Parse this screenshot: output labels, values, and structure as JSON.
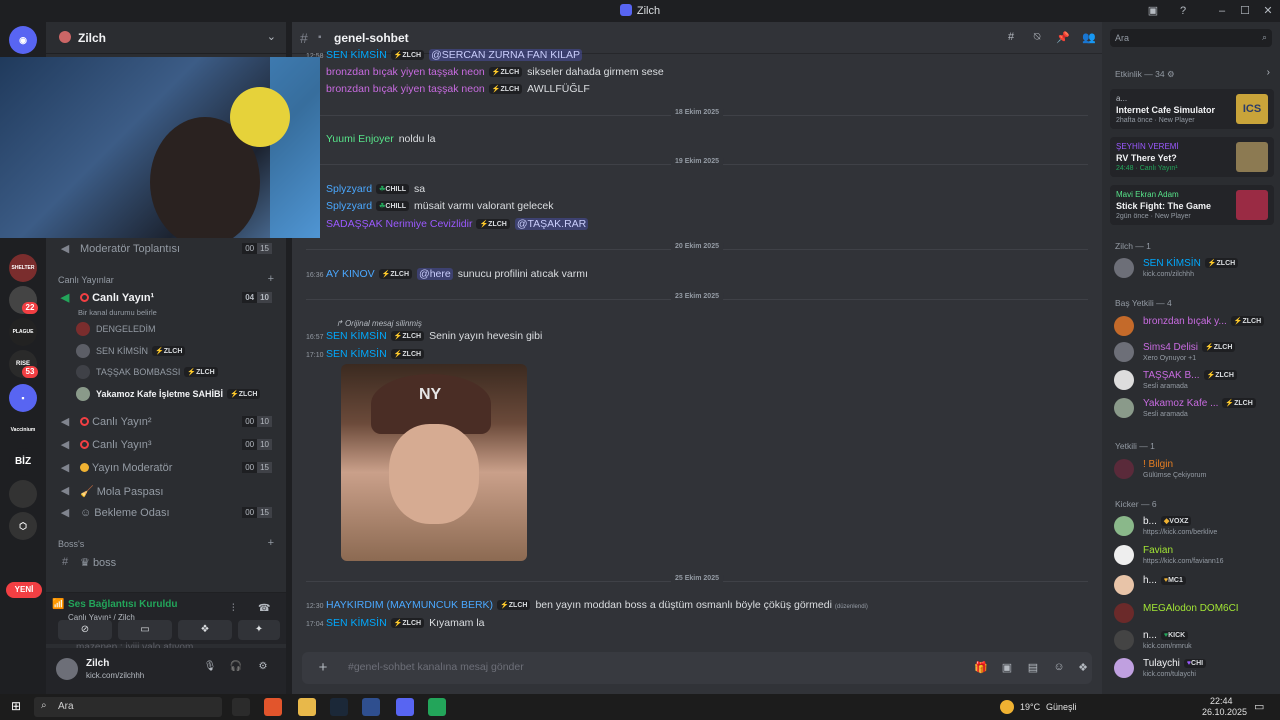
{
  "window": {
    "title": "Zilch"
  },
  "server": {
    "name": "Zilch",
    "badges": [
      "22",
      "53"
    ],
    "new_label": "YENİ",
    "rail_labels": [
      "BİZ",
      "SHELTER",
      "PLAGUE",
      "RISE",
      "Vaccinium"
    ]
  },
  "sidebar": {
    "channels_top": [
      {
        "label": "Moderatör Toplantısı",
        "count_a": "00",
        "count_b": "15"
      }
    ],
    "category_live": "Canlı Yayınlar",
    "live_channel": {
      "label": "Canlı Yayın¹",
      "count_a": "04",
      "count_b": "10",
      "status": "Bir kanal durumu belirle"
    },
    "voice_users": [
      {
        "name": "DENGELEDİM",
        "tag": ""
      },
      {
        "name": "SEN KİMSİN",
        "tag": "ZLCH"
      },
      {
        "name": "TAŞŞAK BOMBASSI",
        "tag": "ZLCH"
      },
      {
        "name": "Yakamoz Kafe İşletme SAHİBİ",
        "tag": "ZLCH"
      }
    ],
    "channels_more": [
      {
        "label": "Canlı Yayın²",
        "count_a": "00",
        "count_b": "10"
      },
      {
        "label": "Canlı Yayın³",
        "count_a": "00",
        "count_b": "10"
      },
      {
        "label": "Yayın Moderatör",
        "count_a": "00",
        "count_b": "15"
      },
      {
        "label": "Mola Paspası",
        "count_a": "",
        "count_b": ""
      },
      {
        "label": "Bekleme Odası",
        "count_a": "00",
        "count_b": "15"
      }
    ],
    "category_boss": "Boss's",
    "boss_channel": "boss",
    "ghost_message": "mazenep : iyiii valo atıyom",
    "voice_panel": {
      "title": "Ses Bağlantısı Kuruldu",
      "subtitle": "Canlı Yayın¹ / Zilch"
    },
    "user": {
      "name": "Zilch",
      "status": "kick.com/zilchhh"
    }
  },
  "chat": {
    "channel": "genel-sohbet",
    "composer_placeholder": "#genel-sohbet kanalına mesaj gönder",
    "messages_a": [
      {
        "time": "12:58",
        "author": "SEN KİMSİN",
        "author_color": "#00a8fc",
        "tag": "ZLCH",
        "body": "",
        "mention": "@SERCAN ZURNA FAN KILAP"
      },
      {
        "time": "",
        "author": "bronzdan bıçak yiyen taşşak neon",
        "author_color": "#c86be0",
        "tag": "ZLCH",
        "body": "sikseler dahada girmem sese",
        "mention": ""
      },
      {
        "time": "",
        "author": "bronzdan bıçak yiyen taşşak neon",
        "author_color": "#c86be0",
        "tag": "ZLCH",
        "body": "AWLLFÜĞLF",
        "mention": ""
      }
    ],
    "date_1": "18 Ekim 2025",
    "messages_b": [
      {
        "time": "",
        "author": "Yuumi Enjoyer",
        "author_color": "#57e389",
        "tag": "",
        "body": "noldu la",
        "mention": ""
      }
    ],
    "date_2": "19 Ekim 2025",
    "messages_c": [
      {
        "time": "",
        "author": "Splyzyard",
        "author_color": "#4aa8ff",
        "tag": "CHILL",
        "body": "sa",
        "mention": ""
      },
      {
        "time": "",
        "author": "Splyzyard",
        "author_color": "#4aa8ff",
        "tag": "CHILL",
        "body": "müsait varmı valorant gelecek",
        "mention": ""
      },
      {
        "time": "",
        "author": "SADAŞŞAK Nerimiye Cevizlidir",
        "author_color": "#9b59ff",
        "tag": "ZLCH",
        "body": "",
        "mention": "@TAŞAK.RAR"
      }
    ],
    "date_3": "20 Ekim 2025",
    "messages_d": [
      {
        "time": "16:36",
        "author": "AY KINOV",
        "author_color": "#4aa8ff",
        "tag": "ZLCH",
        "body": "sunucu profilini atıcak varmı",
        "mention": "@here"
      }
    ],
    "date_4": "23 Ekim 2025",
    "reply_note": "Orijinal mesaj silinmiş",
    "messages_e": [
      {
        "time": "16:57",
        "author": "SEN KİMSİN",
        "author_color": "#00a8fc",
        "tag": "ZLCH",
        "body": "Senin yayın hevesin gibi",
        "mention": ""
      },
      {
        "time": "17:10",
        "author": "SEN KİMSİN",
        "author_color": "#00a8fc",
        "tag": "ZLCH",
        "body": "",
        "mention": ""
      }
    ],
    "image_logo": "NY",
    "date_5": "25 Ekim 2025",
    "messages_f": [
      {
        "time": "12:30",
        "author": "HAYKIRDIM (MAYMUNCUK BERK)",
        "author_color": "#4aa8ff",
        "tag": "ZLCH",
        "body": "ben yayın moddan boss a düştüm osmanlı böyle çöküş görmedi",
        "mention": "",
        "edited": "(düzenlendi)"
      },
      {
        "time": "17:04",
        "author": "SEN KİMSİN",
        "author_color": "#00a8fc",
        "tag": "ZLCH",
        "body": "Kıyamam la",
        "mention": ""
      }
    ]
  },
  "members": {
    "search_placeholder": "Ara",
    "activity_header": "Etkinlik — 34",
    "activities": [
      {
        "user": "a...",
        "game": "Internet Cafe Simulator",
        "meta": "2hafta önce · New Player",
        "thumb_color": "#c9a43a",
        "thumb_text": "ICS"
      },
      {
        "user": "ŞEYHİN VEREMİ",
        "game": "RV There Yet?",
        "meta": "24:48 · Canlı Yayın¹",
        "thumb_color": "#8c7a52",
        "thumb_text": ""
      },
      {
        "user": "Mavi Ekran Adam",
        "game": "Stick Fight: The Game",
        "meta": "2gün önce · New Player",
        "thumb_color": "#9a2b44",
        "thumb_text": ""
      }
    ],
    "group_zilch": "Zilch — 1",
    "zilch_members": [
      {
        "name": "SEN KİMSİN",
        "color": "#00a8fc",
        "tag": "ZLCH",
        "sub": "kick.com/zilchhh"
      }
    ],
    "group_bas": "Baş Yetkili — 4",
    "bas_members": [
      {
        "name": "bronzdan bıçak y...",
        "color": "#c86be0",
        "tag": "ZLCH",
        "sub": ""
      },
      {
        "name": "Sims4 Delisi",
        "color": "#c86be0",
        "tag": "ZLCH",
        "sub": "Xero Oynuyor +1"
      },
      {
        "name": "TAŞŞAK B...",
        "color": "#c86be0",
        "tag": "ZLCH",
        "sub": "Sesli aramada"
      },
      {
        "name": "Yakamoz Kafe ...",
        "color": "#c86be0",
        "tag": "ZLCH",
        "sub": "Sesli aramada"
      }
    ],
    "group_yetkili": "Yetkili — 1",
    "yetkili_members": [
      {
        "name": "! Bilgin",
        "color": "#e67e22",
        "tag": "",
        "sub": "Gülümse Çekiyorum"
      }
    ],
    "group_kicker": "Kicker — 6",
    "kicker_members": [
      {
        "name": "b...",
        "color": "#f2f3f5",
        "tag": "VOXZ",
        "sub": "https://kick.com/berklive"
      },
      {
        "name": "Favian",
        "color": "#a3e635",
        "tag": "",
        "sub": "https://kick.com/faviann16"
      },
      {
        "name": "h...",
        "color": "#f2f3f5",
        "tag": "MC1",
        "sub": ""
      },
      {
        "name": "MEGAlodon DOM6CI",
        "color": "#a3e635",
        "tag": "",
        "sub": ""
      },
      {
        "name": "n...",
        "color": "#f2f3f5",
        "tag": "KICK",
        "sub": "kick.com/nmruk"
      },
      {
        "name": "Tulaychi",
        "color": "#f2f3f5",
        "tag": "CHI",
        "sub": "kick.com/tulaychi"
      }
    ]
  },
  "taskbar": {
    "search_label": "Ara",
    "weather": "19°C",
    "weather_label": "Güneşli",
    "time": "22:44",
    "date": "26.10.2025"
  },
  "colors": {
    "accent": "#5865f2",
    "online": "#23a55a",
    "danger": "#f23f43"
  }
}
